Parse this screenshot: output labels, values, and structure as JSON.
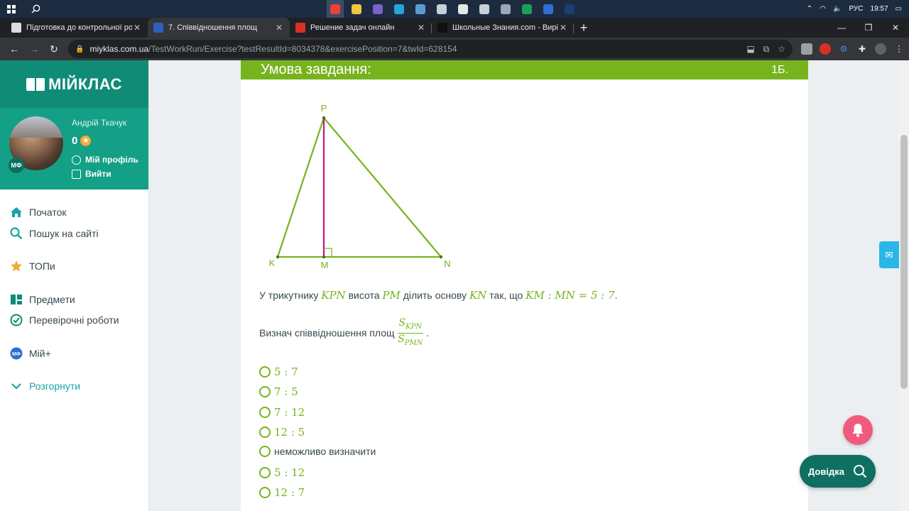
{
  "taskbar": {
    "search_icon": "search-icon",
    "lang": "РУС",
    "time": "19:57",
    "apps": [
      {
        "name": "chrome",
        "color": "#e94235",
        "active": true
      },
      {
        "name": "files",
        "color": "#f4c542"
      },
      {
        "name": "viber",
        "color": "#7b61c9"
      },
      {
        "name": "telegram",
        "color": "#2aa3dd"
      },
      {
        "name": "app5",
        "color": "#5b9bd5"
      },
      {
        "name": "calc",
        "color": "#c7d0d9"
      },
      {
        "name": "app7",
        "color": "#e6e6e6"
      },
      {
        "name": "usb",
        "color": "#c7d0d9"
      },
      {
        "name": "camera",
        "color": "#9aa7b4"
      },
      {
        "name": "excel",
        "color": "#1f9e55"
      },
      {
        "name": "word",
        "color": "#2f6fd1"
      },
      {
        "name": "photoshop",
        "color": "#1c3f73"
      }
    ]
  },
  "tabs": [
    {
      "title": "Підготовка до контрольної робо",
      "favicon_color": "#dadce0",
      "active": false
    },
    {
      "title": "7. Співвідношення площ",
      "favicon_color": "#2f5fbf",
      "active": true
    },
    {
      "title": "Решение задач онлайн",
      "favicon_color": "#d93025",
      "active": false
    },
    {
      "title": "Школьные Знания.com - Вирішу",
      "favicon_color": "#111111",
      "active": false
    }
  ],
  "address": {
    "host": "miyklas.com.ua",
    "path": "/TestWorkRun/Exercise?testResultId=8034378&exercisePosition=7&twId=628154"
  },
  "sidebar": {
    "logo": "МІЙКЛАС",
    "user_name": "Андрій Ткачук",
    "score": "0",
    "avatar_badge": "МФ",
    "profile_link": "Мій профіль",
    "logout_link": "Вийти",
    "menu": [
      {
        "label": "Початок",
        "icon": "home-icon"
      },
      {
        "label": "Пошук на сайті",
        "icon": "search-icon"
      },
      {
        "label": "ТОПи",
        "icon": "star-icon"
      },
      {
        "label": "Предмети",
        "icon": "books-icon"
      },
      {
        "label": "Перевірочні роботи",
        "icon": "check-circle-icon"
      },
      {
        "label": "Мій+",
        "icon": "myplus-icon"
      },
      {
        "label": "Розгорнути",
        "icon": "chevron-down-icon"
      }
    ]
  },
  "task": {
    "header": "Умова завдання:",
    "points": "1Б.",
    "figure_labels": {
      "P": "P",
      "K": "K",
      "M": "M",
      "N": "N"
    },
    "text_prefix": "У трикутнику",
    "triangle": "KPN",
    "text_height": "висота",
    "height": "PM",
    "text_divides": "ділить основу",
    "base": "KN",
    "text_so": "так, що",
    "ratio": "KM : MN = 5 : 7",
    "question": "Визнач співвідношення площ",
    "frac_num_S": "S",
    "frac_num_sub": "KPN",
    "frac_den_S": "S",
    "frac_den_sub": "PMN",
    "dot": "."
  },
  "options": [
    {
      "label": "5 : 7",
      "math": true
    },
    {
      "label": "7 : 5",
      "math": true
    },
    {
      "label": "7 : 12",
      "math": true
    },
    {
      "label": "12 : 5",
      "math": true
    },
    {
      "label": "неможливо визначити",
      "math": false
    },
    {
      "label": "5 : 12",
      "math": true
    },
    {
      "label": "12 : 7",
      "math": true
    }
  ],
  "help_label": "Довідка"
}
